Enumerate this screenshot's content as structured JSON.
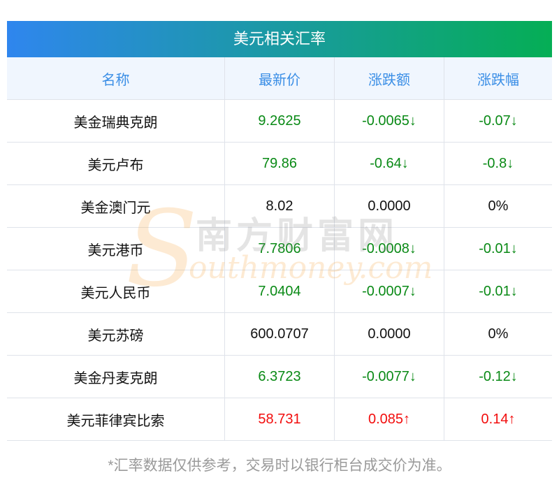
{
  "title": "美元相关汇率",
  "columns": [
    "名称",
    "最新价",
    "涨跌额",
    "涨跌幅"
  ],
  "rows": [
    {
      "name": "美金瑞典克朗",
      "price": "9.2625",
      "change": "-0.0065↓",
      "pct": "-0.07↓",
      "trend": "down"
    },
    {
      "name": "美元卢布",
      "price": "79.86",
      "change": "-0.64↓",
      "pct": "-0.8↓",
      "trend": "down"
    },
    {
      "name": "美金澳门元",
      "price": "8.02",
      "change": "0.0000",
      "pct": "0%",
      "trend": "flat"
    },
    {
      "name": "美元港币",
      "price": "7.7806",
      "change": "-0.0008↓",
      "pct": "-0.01↓",
      "trend": "down"
    },
    {
      "name": "美元人民币",
      "price": "7.0404",
      "change": "-0.0007↓",
      "pct": "-0.01↓",
      "trend": "down"
    },
    {
      "name": "美元苏磅",
      "price": "600.0707",
      "change": "0.0000",
      "pct": "0%",
      "trend": "flat"
    },
    {
      "name": "美金丹麦克朗",
      "price": "6.3723",
      "change": "-0.0077↓",
      "pct": "-0.12↓",
      "trend": "down"
    },
    {
      "name": "美元菲律宾比索",
      "price": "58.731",
      "change": "0.085↑",
      "pct": "0.14↑",
      "trend": "up"
    }
  ],
  "footer": "*汇率数据仅供参考，交易时以银行柜台成交价为准。",
  "watermark": {
    "cn": "南方财富网",
    "en": "outhmoney.com",
    "s": "S"
  },
  "colors": {
    "up": "#f20d0d",
    "down": "#0a8a16",
    "header_text": "#3a8ee6",
    "gradient_start": "#2f86ee",
    "gradient_end": "#05ae55"
  }
}
